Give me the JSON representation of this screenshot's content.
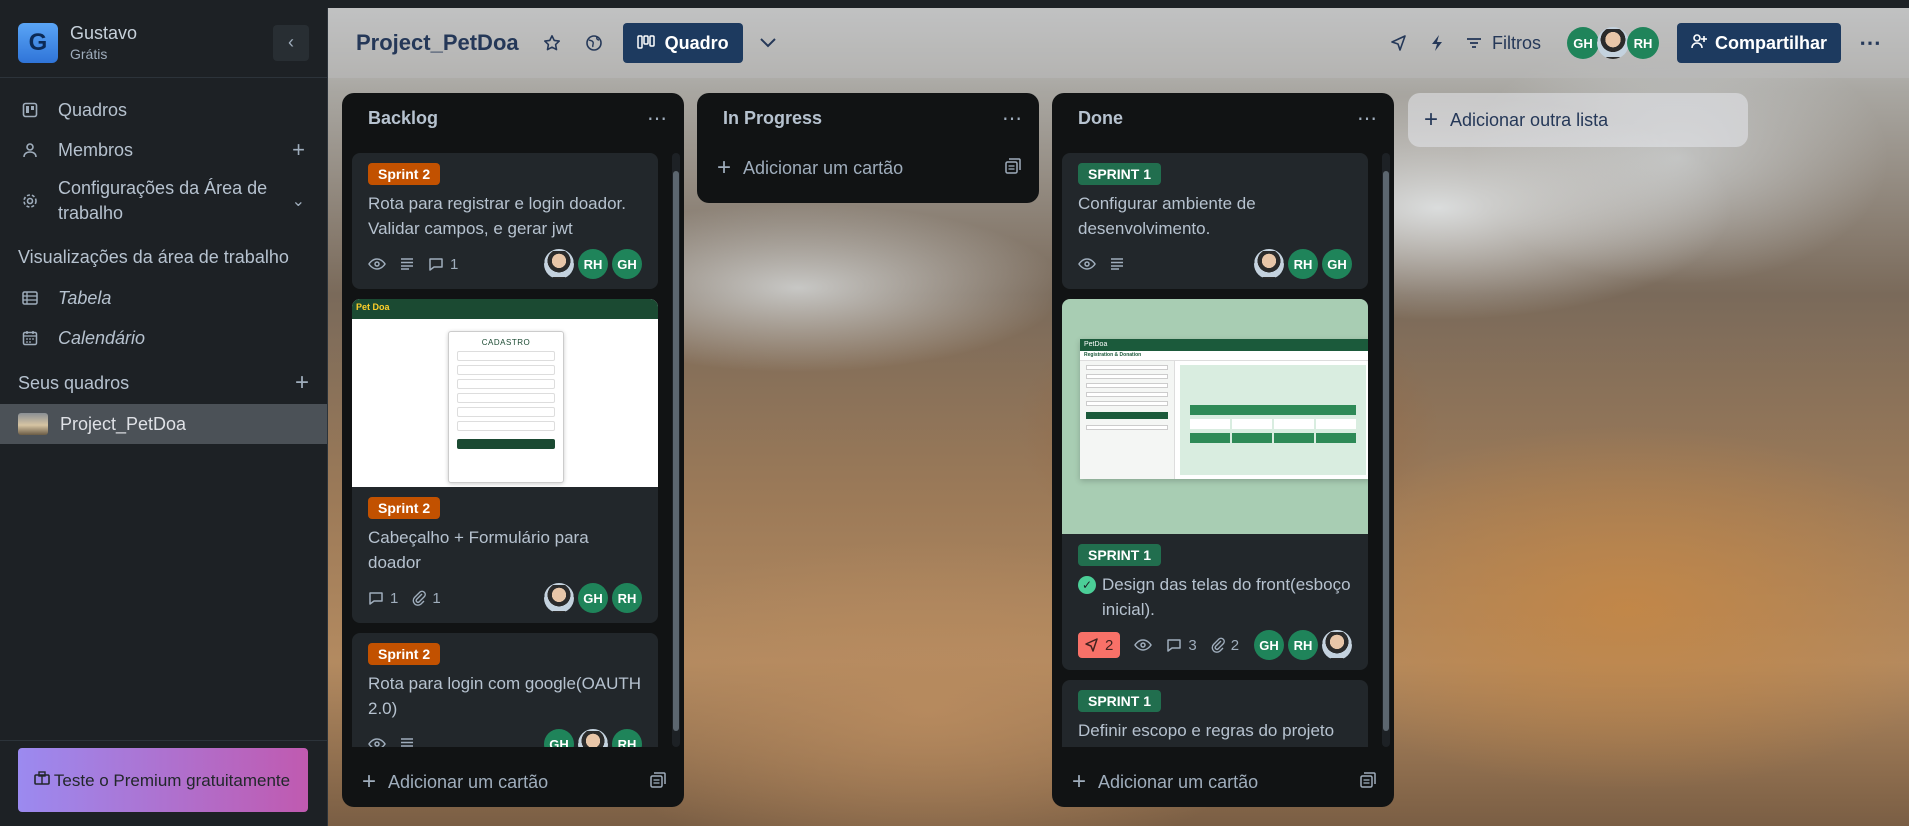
{
  "workspace": {
    "initial": "G",
    "name": "Gustavo",
    "plan": "Grátis"
  },
  "sidebar": {
    "items": [
      {
        "label": "Quadros",
        "icon": "board-icon"
      },
      {
        "label": "Membros",
        "icon": "person-icon"
      },
      {
        "label": "Configurações da Área de trabalho",
        "icon": "gear-icon"
      }
    ],
    "views_title": "Visualizações da área de trabalho",
    "views": [
      {
        "label": "Tabela",
        "icon": "table-icon"
      },
      {
        "label": "Calendário",
        "icon": "calendar-icon"
      }
    ],
    "boards_title": "Seus quadros",
    "boards": [
      {
        "label": "Project_PetDoa"
      }
    ],
    "premium_label": "Teste o Premium gratuitamente"
  },
  "header": {
    "title": "Project_PetDoa",
    "view_label": "Quadro",
    "filters_label": "Filtros",
    "members": [
      "GH",
      "RH"
    ],
    "share_label": "Compartilhar"
  },
  "lists": [
    {
      "title": "Backlog",
      "add_label": "Adicionar um cartão",
      "cards": [
        {
          "label": "Sprint 2",
          "title": "Rota para registrar e login doador. Validar campos, e gerar jwt",
          "comments": "1",
          "members": [
            "RH",
            "GH"
          ]
        },
        {
          "cover_title": "CADASTRO",
          "cover_brand": "Pet Doa",
          "label": "Sprint 2",
          "title": "Cabeçalho + Formulário para doador",
          "comments": "1",
          "attachments": "1",
          "members": [
            "GH",
            "RH"
          ]
        },
        {
          "label": "Sprint 2",
          "title": "Rota para login com google(OAUTH 2.0)",
          "members": [
            "GH",
            "RH"
          ]
        }
      ]
    },
    {
      "title": "In Progress",
      "add_label": "Adicionar um cartão",
      "cards": []
    },
    {
      "title": "Done",
      "add_label": "Adicionar um cartão",
      "cards": [
        {
          "label": "SPRINT 1",
          "title": "Configurar ambiente de desenvolvimento.",
          "members": [
            "RH",
            "GH"
          ]
        },
        {
          "cover_brand": "PetDoa",
          "cover_sub": "Registration & Donation",
          "label": "SPRINT 1",
          "title": "Design das telas do front(esboço inicial).",
          "votes": "2",
          "comments": "3",
          "attachments": "2",
          "members": [
            "GH",
            "RH"
          ]
        },
        {
          "label": "SPRINT 1",
          "title": "Definir escopo e regras do projeto PetDoa."
        }
      ]
    }
  ],
  "add_list_label": "Adicionar outra lista",
  "colors": {
    "label_orange": "#c25100",
    "label_green": "#216e4e",
    "member_green": "#1f845a",
    "primary_button": "#1d3a5f"
  }
}
